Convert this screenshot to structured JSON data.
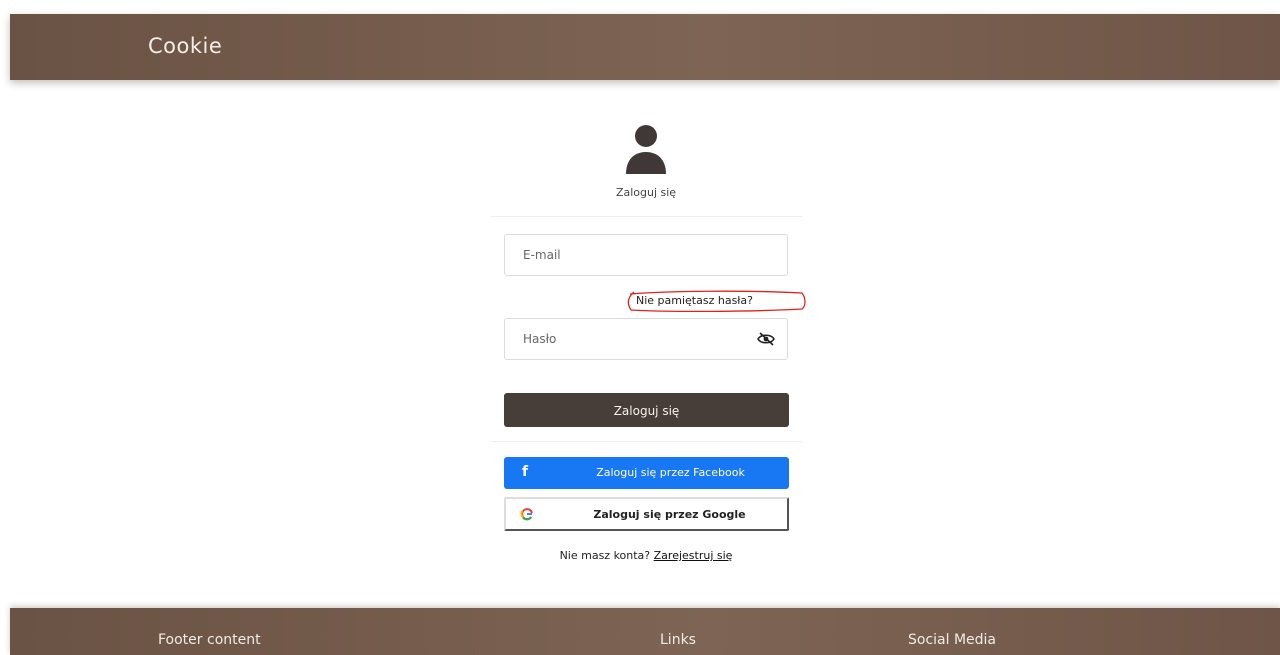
{
  "navbar": {
    "brand": "Cookie"
  },
  "login": {
    "title": "Zaloguj się",
    "email_placeholder": "E-mail",
    "password_placeholder": "Hasło",
    "forgot_password": "Nie pamiętasz hasła?",
    "submit_label": "Zaloguj się",
    "facebook_label": "Zaloguj się przez Facebook",
    "google_label": "Zaloguj się przez Google",
    "no_account_text": "Nie masz konta?",
    "register_link": "Zarejestruj się"
  },
  "footer": {
    "content_heading": "Footer content",
    "links_heading": "Links",
    "social_heading": "Social Media"
  },
  "colors": {
    "brand_brown": "#74594a",
    "dark_button": "#473d39",
    "facebook_blue": "#1877f2",
    "annotation_red": "#e0221e"
  }
}
